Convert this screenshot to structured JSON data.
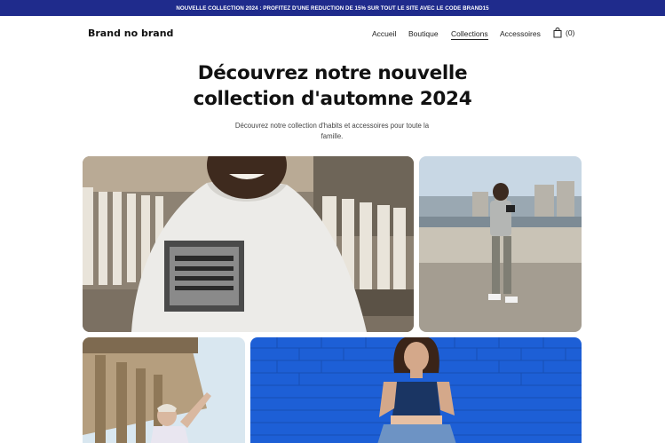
{
  "promo": {
    "text": "NOUVELLE COLLECTION 2024 : PROFITEZ D'UNE REDUCTION DE 15% SUR TOUT LE SITE AVEC LE CODE BRAND15"
  },
  "header": {
    "brand": "Brand no brand",
    "nav": [
      {
        "label": "Accueil",
        "active": false
      },
      {
        "label": "Boutique",
        "active": false
      },
      {
        "label": "Collections",
        "active": true
      },
      {
        "label": "Accessoires",
        "active": false
      }
    ],
    "cart": {
      "icon": "shopping-bag-icon",
      "count": "(0)"
    }
  },
  "hero": {
    "title": "Découvrez notre nouvelle\ncollection d'automne 2024",
    "subtitle": "Découvrez notre collection d'habits et accessoires pour toute la famille."
  },
  "gallery": {
    "images": [
      {
        "name": "man-in-white-hoodie-photo"
      },
      {
        "name": "man-taking-photo-riverside-photo"
      },
      {
        "name": "man-near-columns-photo"
      },
      {
        "name": "woman-blue-brick-wall-photo"
      }
    ]
  },
  "colors": {
    "promo_bg": "#1f2b8c",
    "text": "#111111",
    "brick_blue": "#1d5fd6"
  }
}
